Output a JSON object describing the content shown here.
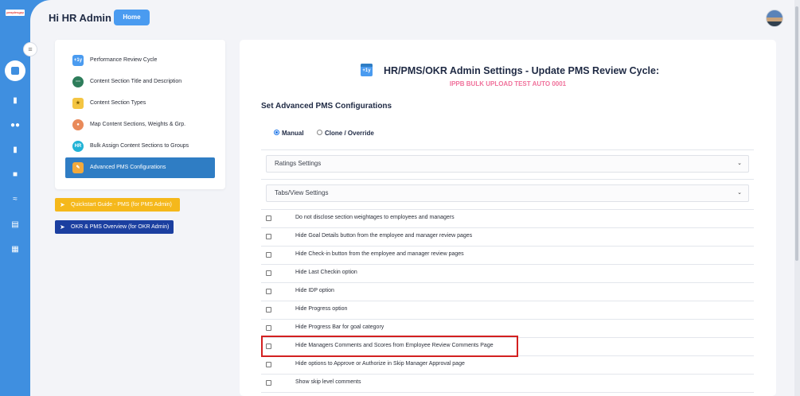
{
  "app": {
    "logo_text": "peoplesgrp",
    "greeting": "Hi HR Admin",
    "home_label": "Home"
  },
  "rail": {
    "icons": [
      "collapse-toggle-icon",
      "dashboard-icon",
      "book-icon",
      "people-icon",
      "book-open-icon",
      "chart-icon",
      "handshake-icon",
      "document-icon",
      "calendar-icon"
    ]
  },
  "menu": {
    "items": [
      {
        "label": "Performance Review Cycle",
        "icon": "calendar-icon"
      },
      {
        "label": "Content Section Title and Description",
        "icon": "dots-icon"
      },
      {
        "label": "Content Section Types",
        "icon": "trophy-icon"
      },
      {
        "label": "Map Content Sections, Weights & Grp.",
        "icon": "user-map-icon"
      },
      {
        "label": "Bulk Assign Content Sections to Groups",
        "icon": "hr-badge-icon"
      },
      {
        "label": "Advanced PMS Configurations",
        "icon": "config-icon"
      }
    ],
    "active_index": 5
  },
  "guides": {
    "quickstart_label": "Quickstart Guide - PMS (for PMS Admin)",
    "quickstart_color": "#f5b81b",
    "overview_label": "OKR & PMS Overview (for OKR Admin)",
    "overview_color": "#1b3fa0"
  },
  "main": {
    "title": "HR/PMS/OKR Admin Settings - Update PMS Review Cycle:",
    "cycle_name": "IPPB BULK UPLOAD TEST AUTO 0001",
    "section_title": "Set Advanced PMS Configurations",
    "modes": [
      {
        "label": "Manual",
        "selected": true
      },
      {
        "label": "Clone / Override",
        "selected": false
      }
    ],
    "accordions": [
      {
        "label": "Ratings Settings"
      },
      {
        "label": "Tabs/View Settings"
      }
    ],
    "options": [
      {
        "label": "Do not disclose section weightages to employees and managers",
        "checked": false
      },
      {
        "label": "Hide Goal Details button from the employee and manager review pages",
        "checked": false
      },
      {
        "label": "Hide Check-in button from the employee and manager review pages",
        "checked": false
      },
      {
        "label": "Hide Last Checkin option",
        "checked": false
      },
      {
        "label": "Hide IDP option",
        "checked": false
      },
      {
        "label": "Hide Progress option",
        "checked": false
      },
      {
        "label": "Hide Progress Bar for goal category",
        "checked": false
      },
      {
        "label": "Hide Managers Comments and Scores from Employee Review Comments Page",
        "checked": false
      },
      {
        "label": "Hide options to Approve or Authorize in Skip Manager Approval page",
        "checked": false
      },
      {
        "label": "Show skip level comments",
        "checked": false
      }
    ],
    "highlighted_option_index": 7
  },
  "colors": {
    "accent": "#3f8fe0",
    "active_menu": "#2f7dc4",
    "subtitle_pink": "#f0719b",
    "highlight_red": "#d32020"
  }
}
